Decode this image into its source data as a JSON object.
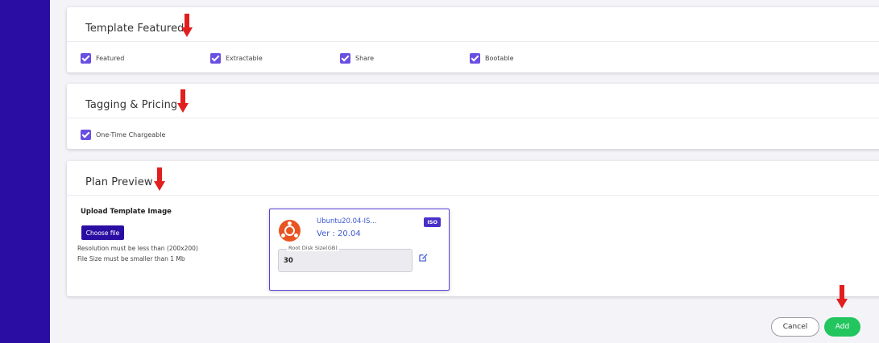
{
  "sections": {
    "template_featured": {
      "title": "Template Featured",
      "checkboxes": [
        {
          "label": "Featured",
          "checked": true
        },
        {
          "label": "Extractable",
          "checked": true
        },
        {
          "label": "Share",
          "checked": true
        },
        {
          "label": "Bootable",
          "checked": true
        }
      ]
    },
    "tagging_pricing": {
      "title": "Tagging & Pricing",
      "checkboxes": [
        {
          "label": "One-Time Chargeable",
          "checked": true
        }
      ]
    },
    "plan_preview": {
      "title": "Plan Preview",
      "upload_title": "Upload Template Image",
      "choose_file_label": "Choose file",
      "hint_resolution": "Resolution must be less than (200x200)",
      "hint_size": "File Size must be smaller than 1 Mb",
      "preview_card": {
        "os_name": "Ubuntu20.04-IS...",
        "version": "Ver : 20.04",
        "badge": "ISO",
        "disk_label": "Root Disk Size(GB)",
        "disk_value": "30"
      }
    }
  },
  "actions": {
    "cancel_label": "Cancel",
    "add_label": "Add"
  },
  "colors": {
    "sidebar": "#2a0ea3",
    "checkbox": "#6a4fe3",
    "arrow": "#e21e1e",
    "add_button": "#22c55e",
    "os_logo": "#e95420"
  },
  "icons": [
    "red-down-arrow-icon",
    "checkbox-checked-icon",
    "ubuntu-logo-icon",
    "edit-icon"
  ]
}
